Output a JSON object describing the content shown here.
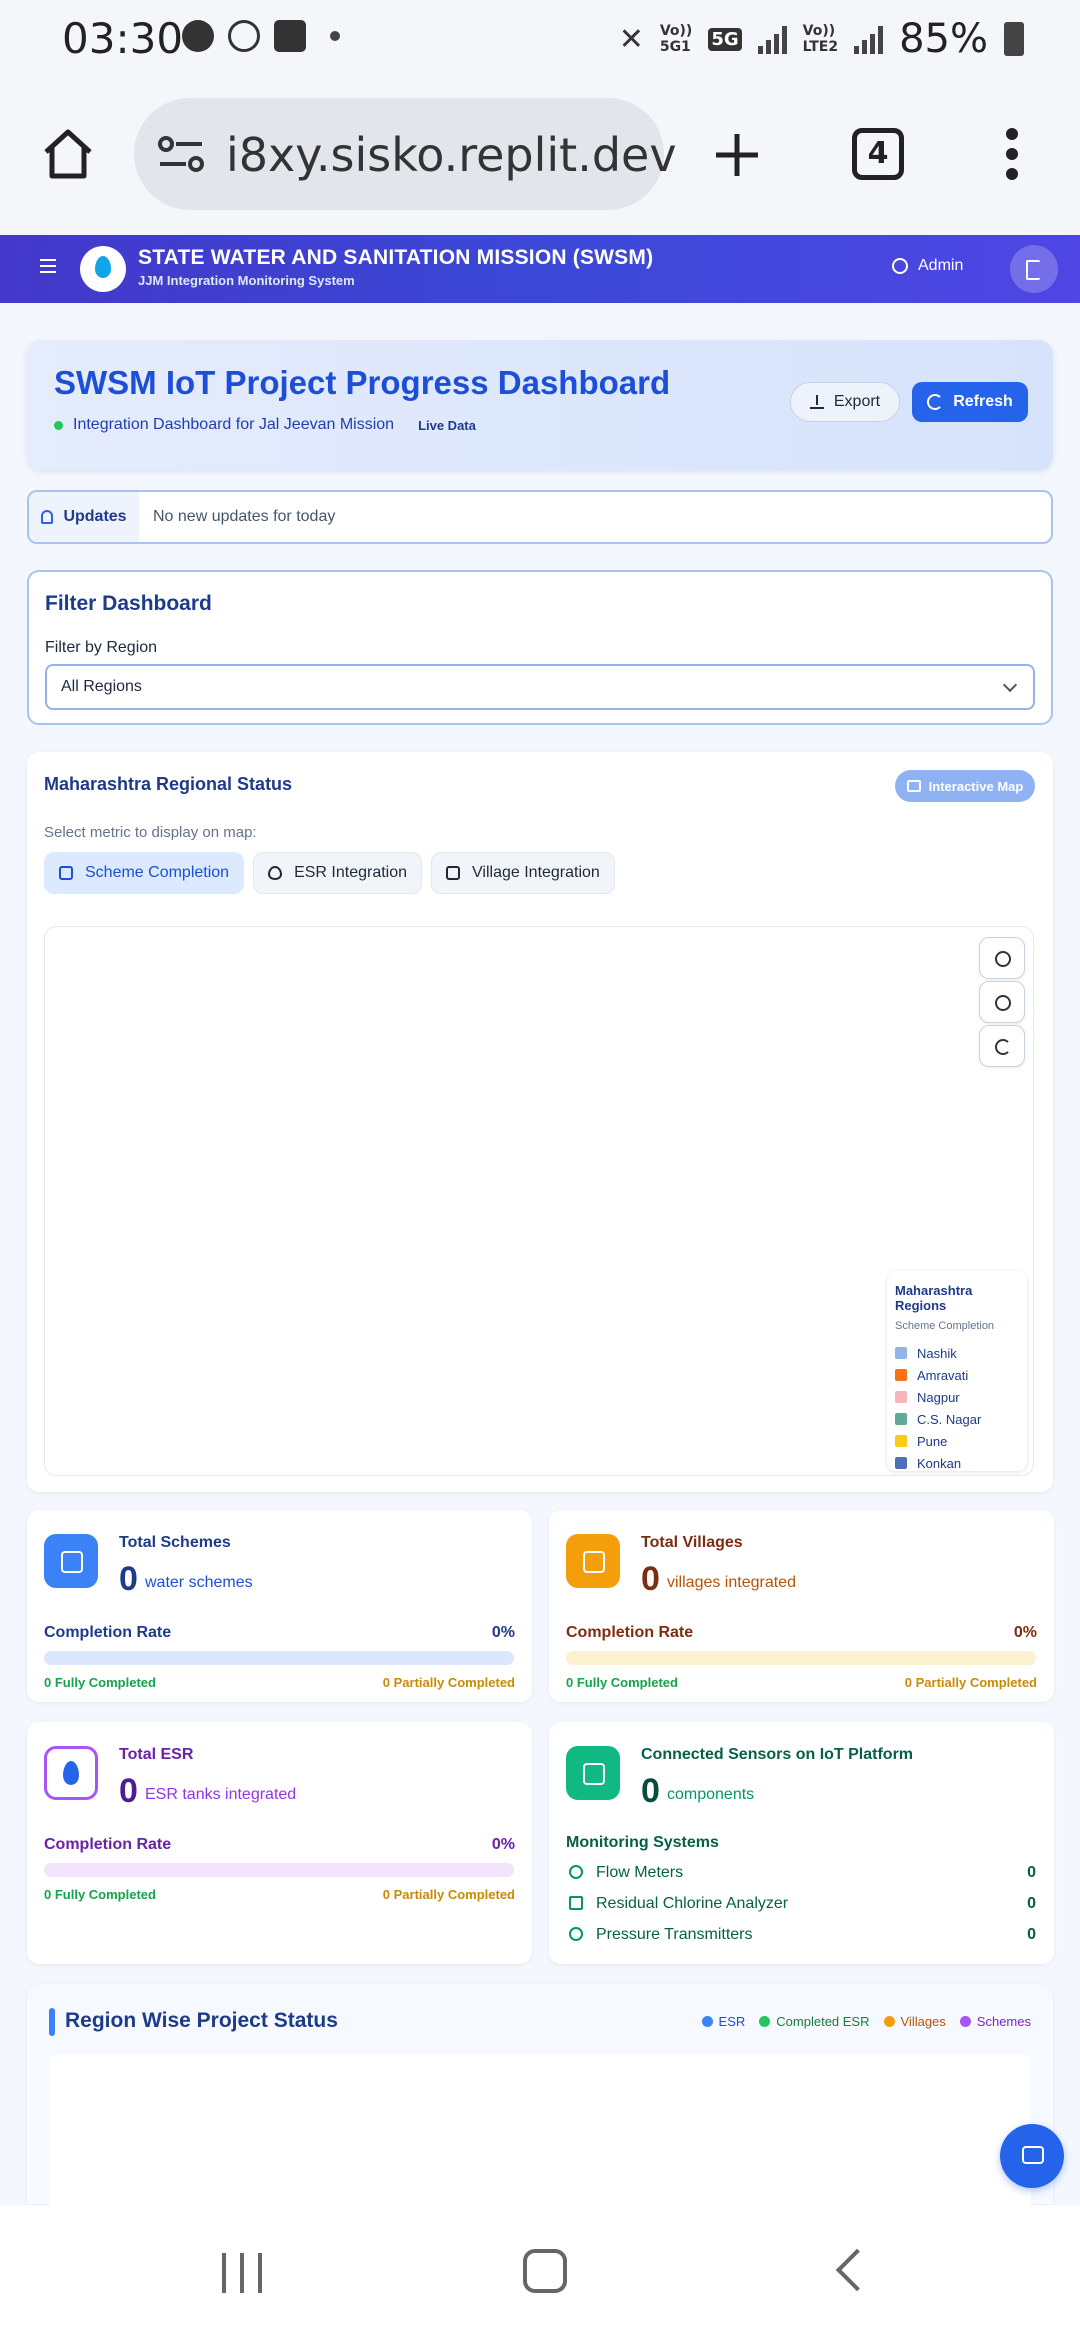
{
  "status_bar": {
    "time": "03:30",
    "net1_top": "Vo))",
    "net1_bottom": "5G1",
    "net_5g": "5G",
    "net2_top": "Vo))",
    "net2_bottom": "LTE2",
    "battery": "85%"
  },
  "browser": {
    "url": "i8xy.sisko.replit.dev",
    "tab_count": "4",
    "icons": [
      "home-icon",
      "site-settings-icon",
      "new-tab-plus-icon",
      "more-vert-icon"
    ]
  },
  "header": {
    "title": "STATE WATER AND SANITATION MISSION (SWSM)",
    "subtitle": "JJM Integration Monitoring System",
    "admin_label": "Admin"
  },
  "dashboard": {
    "title": "SWSM IoT Project Progress Dashboard",
    "subtitle": "Integration Dashboard for Jal Jeevan Mission",
    "live_badge": "Live Data",
    "export_label": "Export",
    "refresh_label": "Refresh"
  },
  "updates": {
    "label": "Updates",
    "text": "No new updates for today"
  },
  "filter": {
    "title": "Filter Dashboard",
    "label": "Filter by Region",
    "selected": "All Regions"
  },
  "map": {
    "title": "Maharashtra Regional Status",
    "badge": "Interactive Map",
    "metric_label": "Select metric to display on map:",
    "tabs": [
      {
        "label": "Scheme Completion",
        "active": true
      },
      {
        "label": "ESR Integration",
        "active": false
      },
      {
        "label": "Village Integration",
        "active": false
      }
    ],
    "legend": {
      "title": "Maharashtra Regions",
      "subtitle": "Scheme Completion",
      "items": [
        {
          "label": "Nashik",
          "color": "#93b4ea"
        },
        {
          "label": "Amravati",
          "color": "#f97316"
        },
        {
          "label": "Nagpur",
          "color": "#f4b6b6"
        },
        {
          "label": "C.S. Nagar",
          "color": "#5fa89a"
        },
        {
          "label": "Pune",
          "color": "#facc15"
        },
        {
          "label": "Konkan",
          "color": "#4f6fb8"
        }
      ]
    }
  },
  "stats": {
    "schemes": {
      "label": "Total Schemes",
      "value": "0",
      "unit": "water schemes",
      "rate_label": "Completion Rate",
      "rate": "0%",
      "fully": "0 Fully Completed",
      "partial": "0 Partially Completed"
    },
    "villages": {
      "label": "Total Villages",
      "value": "0",
      "unit": "villages integrated",
      "rate_label": "Completion Rate",
      "rate": "0%",
      "fully": "0 Fully Completed",
      "partial": "0 Partially Completed"
    },
    "esr": {
      "label": "Total ESR",
      "value": "0",
      "unit": "ESR tanks integrated",
      "rate_label": "Completion Rate",
      "rate": "0%",
      "fully": "0 Fully Completed",
      "partial": "0 Partially Completed"
    },
    "sensors": {
      "label": "Connected Sensors on IoT Platform",
      "value": "0",
      "unit": "components",
      "monitoring_title": "Monitoring Systems",
      "items": [
        {
          "name": "Flow Meters",
          "value": "0"
        },
        {
          "name": "Residual Chlorine Analyzer",
          "value": "0"
        },
        {
          "name": "Pressure Transmitters",
          "value": "0"
        }
      ]
    }
  },
  "region_status": {
    "title": "Region Wise Project Status",
    "legend": [
      {
        "label": "ESR",
        "color": "#3b82f6"
      },
      {
        "label": "Completed ESR",
        "color": "#22c55e"
      },
      {
        "label": "Villages",
        "color": "#f59e0b"
      },
      {
        "label": "Schemes",
        "color": "#a855f7"
      }
    ]
  },
  "colors": {
    "primary": "#2563eb",
    "header_gradient": [
      "#4338ca",
      "#4f46e5"
    ],
    "schemes": "#3b82f6",
    "villages": "#f59e0b",
    "esr": "#a855f7",
    "sensors": "#10b981"
  }
}
